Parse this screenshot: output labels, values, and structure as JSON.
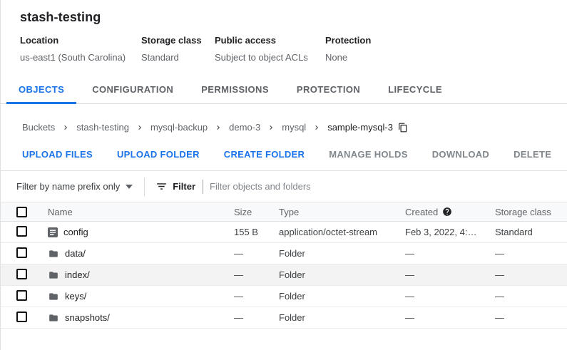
{
  "colors": {
    "accent": "#1a73e8",
    "text_primary": "#202124",
    "text_secondary": "#5f6368",
    "disabled_text": "#80868b",
    "divider": "#e0e0e0",
    "table_header_bg": "#f8f9fa",
    "row_highlight_bg": "#f3f3f3",
    "icon_gray": "#5f6368"
  },
  "icons": {
    "breadcrumb_separator": "chevron-right",
    "copy": "content-copy",
    "scope_caret": "caret-down",
    "filter": "filter-list",
    "created_help": "help-filled-question-mark",
    "file": "document-lines",
    "folder": "folder-filled"
  },
  "header": {
    "title": "stash-testing",
    "meta": [
      {
        "label": "Location",
        "value": "us-east1 (South Carolina)"
      },
      {
        "label": "Storage class",
        "value": "Standard"
      },
      {
        "label": "Public access",
        "value": "Subject to object ACLs"
      },
      {
        "label": "Protection",
        "value": "None"
      }
    ]
  },
  "tabs": [
    {
      "label": "OBJECTS",
      "active": true
    },
    {
      "label": "CONFIGURATION",
      "active": false
    },
    {
      "label": "PERMISSIONS",
      "active": false
    },
    {
      "label": "PROTECTION",
      "active": false
    },
    {
      "label": "LIFECYCLE",
      "active": false
    }
  ],
  "breadcrumb": {
    "items": [
      "Buckets",
      "stash-testing",
      "mysql-backup",
      "demo-3",
      "mysql",
      "sample-mysql-3"
    ]
  },
  "toolbar": {
    "buttons": [
      {
        "label": "UPLOAD FILES",
        "enabled": true
      },
      {
        "label": "UPLOAD FOLDER",
        "enabled": true
      },
      {
        "label": "CREATE FOLDER",
        "enabled": true
      },
      {
        "label": "MANAGE HOLDS",
        "enabled": false
      },
      {
        "label": "DOWNLOAD",
        "enabled": false
      },
      {
        "label": "DELETE",
        "enabled": false
      }
    ]
  },
  "filter": {
    "scope": "Filter by name prefix only",
    "label": "Filter",
    "placeholder": "Filter objects and folders"
  },
  "table": {
    "headers": {
      "name": "Name",
      "size": "Size",
      "type": "Type",
      "created": "Created",
      "storage": "Storage class"
    },
    "rows": [
      {
        "name": "config",
        "kind": "file",
        "size": "155 B",
        "type": "application/octet-stream",
        "created": "Feb 3, 2022, 4:…",
        "storage": "Standard"
      },
      {
        "name": "data/",
        "kind": "folder",
        "size": "—",
        "type": "Folder",
        "created": "—",
        "storage": "—"
      },
      {
        "name": "index/",
        "kind": "folder",
        "size": "—",
        "type": "Folder",
        "created": "—",
        "storage": "—"
      },
      {
        "name": "keys/",
        "kind": "folder",
        "size": "—",
        "type": "Folder",
        "created": "—",
        "storage": "—"
      },
      {
        "name": "snapshots/",
        "kind": "folder",
        "size": "—",
        "type": "Folder",
        "created": "—",
        "storage": "—"
      }
    ]
  }
}
